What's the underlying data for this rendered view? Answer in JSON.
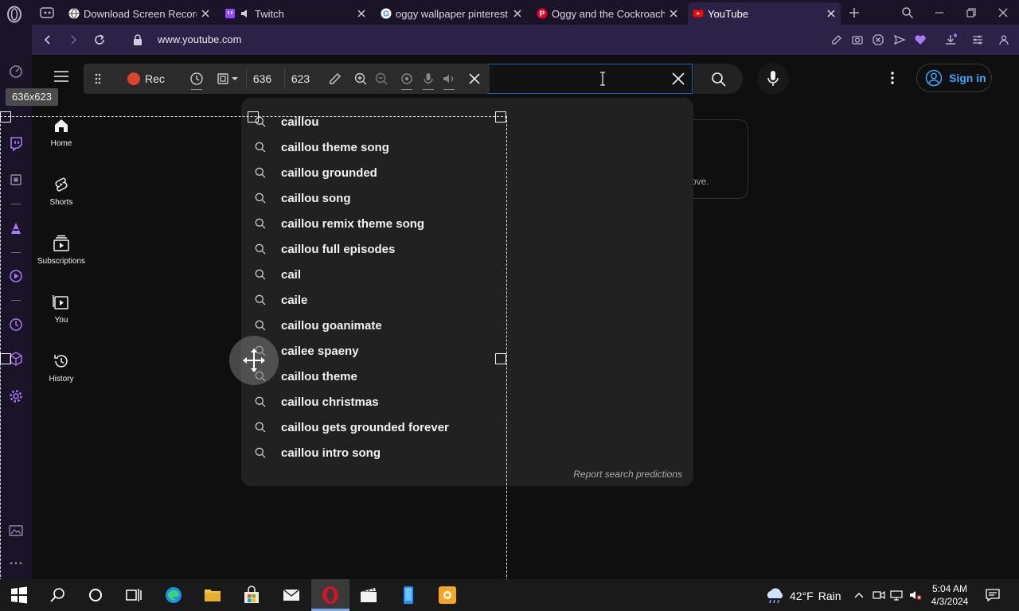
{
  "browser": {
    "tabs": [
      {
        "title": "Download Screen Recorder",
        "favicon": "globe-icon"
      },
      {
        "title": "Twitch",
        "favicon": "twitch-icon"
      },
      {
        "title": "oggy wallpaper pinterest -",
        "favicon": "google-icon"
      },
      {
        "title": "Oggy and the Cockroaches",
        "favicon": "pinterest-icon"
      },
      {
        "title": "YouTube",
        "favicon": "youtube-icon",
        "active": true
      }
    ],
    "url": "www.youtube.com",
    "accent_color": "#2c2147"
  },
  "recorder": {
    "rec_label": "Rec",
    "width": "636",
    "height": "623",
    "size_tag": "636x623",
    "rec_color": "#e0432b"
  },
  "youtube": {
    "nav": [
      {
        "label": "Home",
        "icon": "home-icon"
      },
      {
        "label": "Shorts",
        "icon": "shorts-icon"
      },
      {
        "label": "Subscriptions",
        "icon": "subscriptions-icon"
      },
      {
        "label": "You",
        "icon": "you-icon"
      },
      {
        "label": "History",
        "icon": "history-icon"
      }
    ],
    "sign_in": "Sign in",
    "bg_card_text": "ove.",
    "suggestions": [
      "caillou",
      "caillou theme song",
      "caillou grounded",
      "caillou song",
      "caillou remix theme song",
      "caillou full episodes",
      "cail",
      "caile",
      "caillou goanimate",
      "cailee spaeny",
      "caillou theme",
      "caillou christmas",
      "caillou gets grounded forever",
      "caillou intro song"
    ],
    "report": "Report search predictions",
    "link_color": "#3ea6ff"
  },
  "taskbar": {
    "temperature": "42°F",
    "weather": "Rain",
    "time": "5:04 AM",
    "date": "4/3/2024"
  }
}
